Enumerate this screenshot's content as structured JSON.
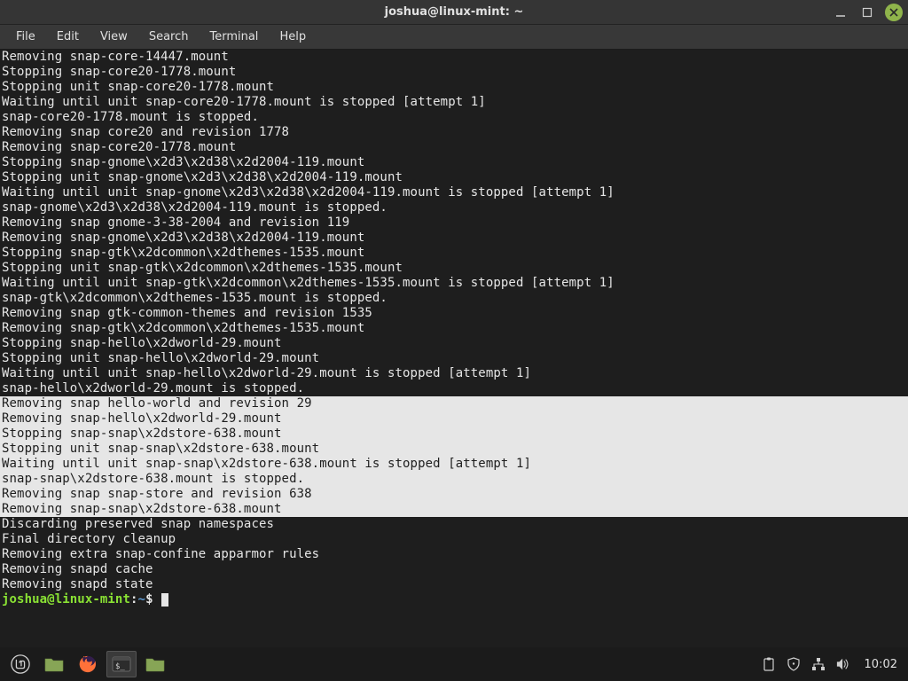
{
  "window": {
    "title": "joshua@linux-mint: ~"
  },
  "menubar": {
    "items": [
      "File",
      "Edit",
      "View",
      "Search",
      "Terminal",
      "Help"
    ]
  },
  "terminal": {
    "lines": [
      {
        "t": "Removing snap-core-14447.mount",
        "sel": false
      },
      {
        "t": "Stopping snap-core20-1778.mount",
        "sel": false
      },
      {
        "t": "Stopping unit snap-core20-1778.mount",
        "sel": false
      },
      {
        "t": "Waiting until unit snap-core20-1778.mount is stopped [attempt 1]",
        "sel": false
      },
      {
        "t": "snap-core20-1778.mount is stopped.",
        "sel": false
      },
      {
        "t": "Removing snap core20 and revision 1778",
        "sel": false
      },
      {
        "t": "Removing snap-core20-1778.mount",
        "sel": false
      },
      {
        "t": "Stopping snap-gnome\\x2d3\\x2d38\\x2d2004-119.mount",
        "sel": false
      },
      {
        "t": "Stopping unit snap-gnome\\x2d3\\x2d38\\x2d2004-119.mount",
        "sel": false
      },
      {
        "t": "Waiting until unit snap-gnome\\x2d3\\x2d38\\x2d2004-119.mount is stopped [attempt 1]",
        "sel": false
      },
      {
        "t": "snap-gnome\\x2d3\\x2d38\\x2d2004-119.mount is stopped.",
        "sel": false
      },
      {
        "t": "Removing snap gnome-3-38-2004 and revision 119",
        "sel": false
      },
      {
        "t": "Removing snap-gnome\\x2d3\\x2d38\\x2d2004-119.mount",
        "sel": false
      },
      {
        "t": "Stopping snap-gtk\\x2dcommon\\x2dthemes-1535.mount",
        "sel": false
      },
      {
        "t": "Stopping unit snap-gtk\\x2dcommon\\x2dthemes-1535.mount",
        "sel": false
      },
      {
        "t": "Waiting until unit snap-gtk\\x2dcommon\\x2dthemes-1535.mount is stopped [attempt 1]",
        "sel": false
      },
      {
        "t": "snap-gtk\\x2dcommon\\x2dthemes-1535.mount is stopped.",
        "sel": false
      },
      {
        "t": "Removing snap gtk-common-themes and revision 1535",
        "sel": false
      },
      {
        "t": "Removing snap-gtk\\x2dcommon\\x2dthemes-1535.mount",
        "sel": false
      },
      {
        "t": "Stopping snap-hello\\x2dworld-29.mount",
        "sel": false
      },
      {
        "t": "Stopping unit snap-hello\\x2dworld-29.mount",
        "sel": false
      },
      {
        "t": "Waiting until unit snap-hello\\x2dworld-29.mount is stopped [attempt 1]",
        "sel": false
      },
      {
        "t": "snap-hello\\x2dworld-29.mount is stopped.",
        "sel": false
      },
      {
        "t": "Removing snap hello-world and revision 29",
        "sel": true
      },
      {
        "t": "Removing snap-hello\\x2dworld-29.mount",
        "sel": true
      },
      {
        "t": "Stopping snap-snap\\x2dstore-638.mount",
        "sel": true
      },
      {
        "t": "Stopping unit snap-snap\\x2dstore-638.mount",
        "sel": true
      },
      {
        "t": "Waiting until unit snap-snap\\x2dstore-638.mount is stopped [attempt 1]",
        "sel": true
      },
      {
        "t": "snap-snap\\x2dstore-638.mount is stopped.",
        "sel": true
      },
      {
        "t": "Removing snap snap-store and revision 638",
        "sel": true
      },
      {
        "t": "Removing snap-snap\\x2dstore-638.mount",
        "sel": true
      },
      {
        "t": "Discarding preserved snap namespaces",
        "sel": false
      },
      {
        "t": "Final directory cleanup",
        "sel": false
      },
      {
        "t": "Removing extra snap-confine apparmor rules",
        "sel": false
      },
      {
        "t": "Removing snapd cache",
        "sel": false
      },
      {
        "t": "Removing snapd state",
        "sel": false
      }
    ],
    "prompt": {
      "user": "joshua@linux-mint",
      "path": "~",
      "sep1": ":",
      "sep2": "$ "
    }
  },
  "taskbar": {
    "clock": "10:02"
  }
}
